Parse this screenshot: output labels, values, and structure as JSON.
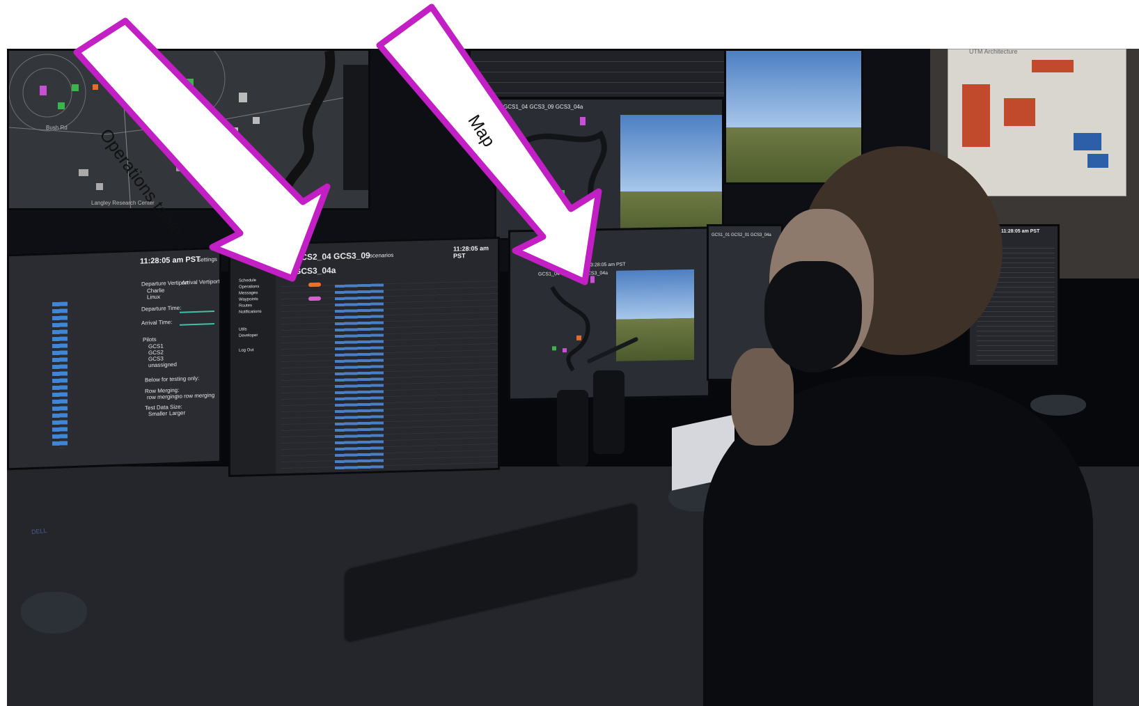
{
  "callouts": [
    {
      "label": "Operations table"
    },
    {
      "label": "Map"
    }
  ],
  "screens": {
    "left_monitor": {
      "time": "11:28:05 am PST",
      "settings": "Settings",
      "departure_vertiport": "Departure Vertiport",
      "arrival_vertiport": "Arrival Vertiport",
      "charlie": "Charlie",
      "linux": "Linux",
      "departure_time": "Departure Time:",
      "arrival_time": "Arrival Time:",
      "pilots": "Pilots",
      "pilot_items": [
        "GCS1",
        "GCS2",
        "GCS3",
        "unassigned"
      ],
      "testing_note": "Below for testing only:",
      "row_merging": "Row Merging:",
      "row_merging_options": [
        "row merging",
        "no row merging"
      ],
      "test_data_size": "Test Data Size:",
      "size_options": [
        "Smaller",
        "Larger"
      ]
    },
    "ops_monitor": {
      "title": "GCS2_04 GCS3_09",
      "subtitle": "scenarios",
      "time": "11:28:05 am PST",
      "heading": "GCS3_04a",
      "nav": [
        "Schedule",
        "Operations",
        "Messages",
        "Waypoints",
        "Routes",
        "Notifications",
        "Utils",
        "Developer",
        "Log Out"
      ]
    },
    "map_monitor": {
      "title": "GCS1_04 GCS3_09 GCS3_04a",
      "time": "3:28:05 am PST"
    },
    "upper_center": {
      "title": "GCS1_04 GCS3_09 GCS3_04a"
    },
    "right_monitor": {
      "title": "GCS1_01 GCS2_01 GCS3_04a",
      "time": "11:28:05 am PST"
    },
    "wall_map": {
      "label_1": "Langley Research Center",
      "label_2": "Bush Rd"
    },
    "poster": {
      "title": "UTM Architecture"
    },
    "monitor_brand": "DELL"
  }
}
